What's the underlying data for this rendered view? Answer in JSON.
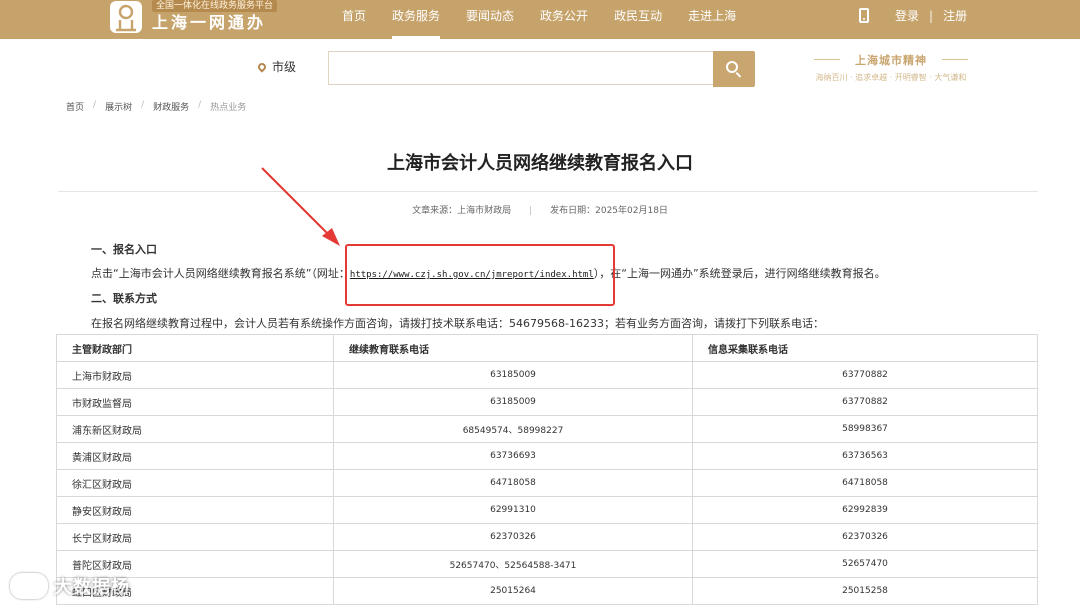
{
  "header": {
    "slogan": "全国一体化在线政务服务平台",
    "site_title": "上海一网通办",
    "nav": [
      "首页",
      "政务服务",
      "要闻动态",
      "政务公开",
      "政民互动",
      "走进上海"
    ],
    "active_nav_index": 1,
    "login": "登录",
    "separator": "|",
    "register": "注册",
    "brand_color": "#c7a36c"
  },
  "search": {
    "location": "市级",
    "placeholder": "",
    "spirit_title": "上海城市精神",
    "spirit_sub": "海纳百川 · 追求卓越 · 开明睿智 · 大气谦和"
  },
  "breadcrumb": [
    "首页",
    "展示树",
    "财政服务",
    "热点业务"
  ],
  "article": {
    "title": "上海市会计人员网络继续教育报名入口",
    "source": "文章来源：上海市财政局",
    "meta_sep": "|",
    "date": "发布日期：2025年02月18日",
    "sec1_heading": "一、报名入口",
    "sec1_prefix": "点击“上海市会计人员网络继续教育报名系统”（网址：",
    "sec1_url": "https://www.czj.sh.gov.cn/jmreport/index.html",
    "sec1_suffix": "），在“上海一网通办”系统登录后，进行网络继续教育报名。",
    "sec2_heading": "二、联系方式",
    "sec2_text": "在报名网络继续教育过程中，会计人员若有系统操作方面咨询，请拨打技术联系电话：54679568-16233；若有业务方面咨询，请拨打下列联系电话："
  },
  "table": {
    "headers": [
      "主管财政部门",
      "继续教育联系电话",
      "信息采集联系电话"
    ],
    "rows": [
      [
        "上海市财政局",
        "63185009",
        "63770882"
      ],
      [
        "市财政监督局",
        "63185009",
        "63770882"
      ],
      [
        "浦东新区财政局",
        "68549574、58998227",
        "58998367"
      ],
      [
        "黄浦区财政局",
        "63736693",
        "63736563"
      ],
      [
        "徐汇区财政局",
        "64718058",
        "64718058"
      ],
      [
        "静安区财政局",
        "62991310",
        "62992839"
      ],
      [
        "长宁区财政局",
        "62370326",
        "62370326"
      ],
      [
        "普陀区财政局",
        "52657470、52564588-3471",
        "52657470"
      ],
      [
        "虹口区财政局",
        "25015264",
        "25015258"
      ]
    ]
  },
  "watermark": "大数据杨"
}
